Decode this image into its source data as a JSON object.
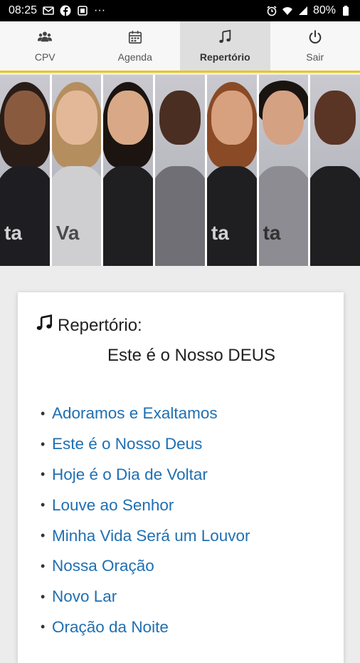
{
  "status_bar": {
    "time": "08:25",
    "more": "···",
    "battery": "80%"
  },
  "nav": {
    "tabs": [
      {
        "label": "CPV",
        "icon": "group-icon",
        "active": false
      },
      {
        "label": "Agenda",
        "icon": "calendar-icon",
        "active": false
      },
      {
        "label": "Repertório",
        "icon": "music-note-icon",
        "active": true
      },
      {
        "label": "Sair",
        "icon": "power-icon",
        "active": false
      }
    ]
  },
  "banner": {
    "panel_count": 7,
    "logo_texts": [
      "ta",
      "Va",
      "ta",
      "ta"
    ]
  },
  "content": {
    "heading": "Repertório:",
    "subtitle": "Este é o Nosso DEUS",
    "songs": [
      "Adoramos e Exaltamos",
      "Este é o Nosso Deus",
      "Hoje é o Dia de Voltar",
      "Louve ao Senhor",
      "Minha Vida Será um Louvor",
      "Nossa Oração",
      "Novo Lar",
      "Oração da Noite"
    ],
    "bullet": "•"
  },
  "colors": {
    "accent": "#e7c619",
    "link": "#1f6fb2",
    "status_bar": "#000000"
  }
}
